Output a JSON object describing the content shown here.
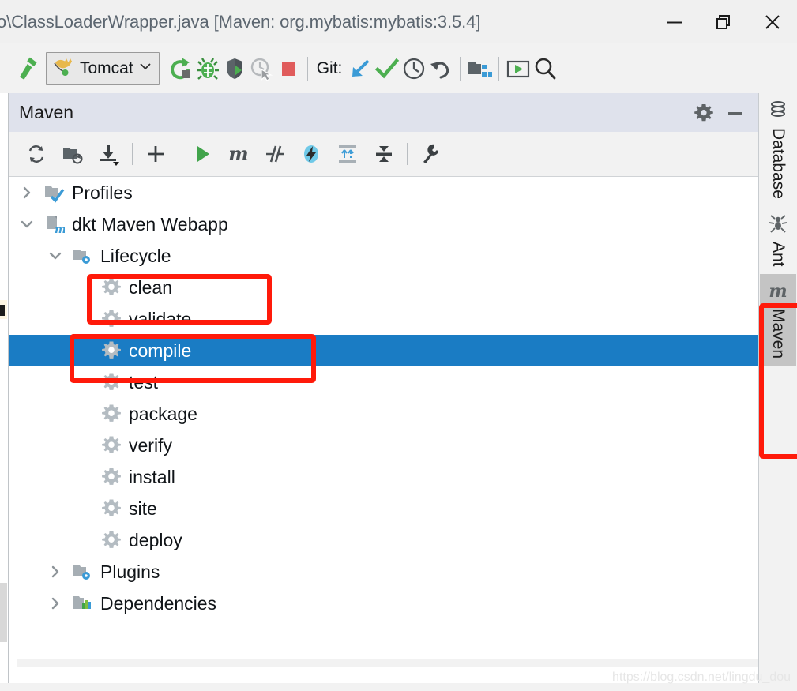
{
  "window": {
    "title": "o\\ClassLoaderWrapper.java [Maven: org.mybatis:mybatis:3.5.4]",
    "controls": {
      "minimize": "minimize-icon",
      "restore": "restore-icon",
      "close": "close-icon"
    }
  },
  "toolbar": {
    "build_icon": "hammer-icon",
    "run_config": {
      "icon": "tomcat-icon",
      "label": "Tomcat",
      "chevron": "chevron-down-icon"
    },
    "run_icon": "run-icon",
    "debug_icon": "debug-icon",
    "run_coverage_icon": "run-with-coverage-icon",
    "profiler_icon": "profiler-icon",
    "stop_icon": "stop-icon",
    "git_label": "Git:",
    "update_project_icon": "update-project-icon",
    "commit_icon": "commit-checkmark-icon",
    "history_icon": "history-clock-icon",
    "rollback_icon": "rollback-icon",
    "project_structure_icon": "project-structure-icon",
    "select_run_icon": "select-run-configuration-icon",
    "search_icon": "search-everywhere-icon"
  },
  "maven_panel": {
    "title": "Maven",
    "header_actions": {
      "settings": "gear-icon",
      "hide": "minimize-icon"
    },
    "toolbar": [
      {
        "name": "reload-all-maven-projects-icon"
      },
      {
        "name": "add-maven-projects-icon"
      },
      {
        "name": "download-sources-and-docs-icon"
      },
      {
        "name": "separator"
      },
      {
        "name": "add-icon"
      },
      {
        "name": "separator"
      },
      {
        "name": "run-maven-build-icon"
      },
      {
        "name": "execute-maven-goal-icon"
      },
      {
        "name": "toggle-skip-tests-icon"
      },
      {
        "name": "toggle-offline-mode-icon"
      },
      {
        "name": "expand-all-icon"
      },
      {
        "name": "collapse-all-icon"
      },
      {
        "name": "separator"
      },
      {
        "name": "maven-settings-wrench-icon"
      }
    ]
  },
  "tree": [
    {
      "label": "Profiles",
      "indent": 0,
      "arrow": "right",
      "icon": "profiles-icon",
      "selected": false
    },
    {
      "label": "dkt Maven Webapp",
      "indent": 0,
      "arrow": "down",
      "icon": "maven-module-icon",
      "selected": false
    },
    {
      "label": "Lifecycle",
      "indent": 1,
      "arrow": "down",
      "icon": "lifecycle-folder-icon",
      "selected": false
    },
    {
      "label": "clean",
      "indent": 2,
      "arrow": "none",
      "icon": "maven-goal-gear-icon",
      "selected": false
    },
    {
      "label": "validate",
      "indent": 2,
      "arrow": "none",
      "icon": "maven-goal-gear-icon",
      "selected": false
    },
    {
      "label": "compile",
      "indent": 2,
      "arrow": "none",
      "icon": "maven-goal-gear-icon",
      "selected": true
    },
    {
      "label": "test",
      "indent": 2,
      "arrow": "none",
      "icon": "maven-goal-gear-icon",
      "selected": false
    },
    {
      "label": "package",
      "indent": 2,
      "arrow": "none",
      "icon": "maven-goal-gear-icon",
      "selected": false
    },
    {
      "label": "verify",
      "indent": 2,
      "arrow": "none",
      "icon": "maven-goal-gear-icon",
      "selected": false
    },
    {
      "label": "install",
      "indent": 2,
      "arrow": "none",
      "icon": "maven-goal-gear-icon",
      "selected": false
    },
    {
      "label": "site",
      "indent": 2,
      "arrow": "none",
      "icon": "maven-goal-gear-icon",
      "selected": false
    },
    {
      "label": "deploy",
      "indent": 2,
      "arrow": "none",
      "icon": "maven-goal-gear-icon",
      "selected": false
    },
    {
      "label": "Plugins",
      "indent": 1,
      "arrow": "right",
      "icon": "plugins-folder-icon",
      "selected": false
    },
    {
      "label": "Dependencies",
      "indent": 1,
      "arrow": "right",
      "icon": "dependencies-icon",
      "selected": false
    }
  ],
  "right_stripe": [
    {
      "label": "Database",
      "icon": "database-icon",
      "active": false
    },
    {
      "label": "Ant",
      "icon": "ant-icon",
      "active": false
    },
    {
      "label": "Maven",
      "icon": "maven-m-icon",
      "active": true
    }
  ],
  "annotations": {
    "color": "#ff1a0a",
    "boxes": [
      "clean-row",
      "compile-row",
      "maven-stripe-button"
    ]
  },
  "watermark": "https://blog.csdn.net/lingdu_dou",
  "colors": {
    "selection": "#1a7cc4",
    "panel_header": "#dfe2ec",
    "toolbar_bg": "#f2f2f2",
    "annotation_red": "#ff1a0a"
  }
}
